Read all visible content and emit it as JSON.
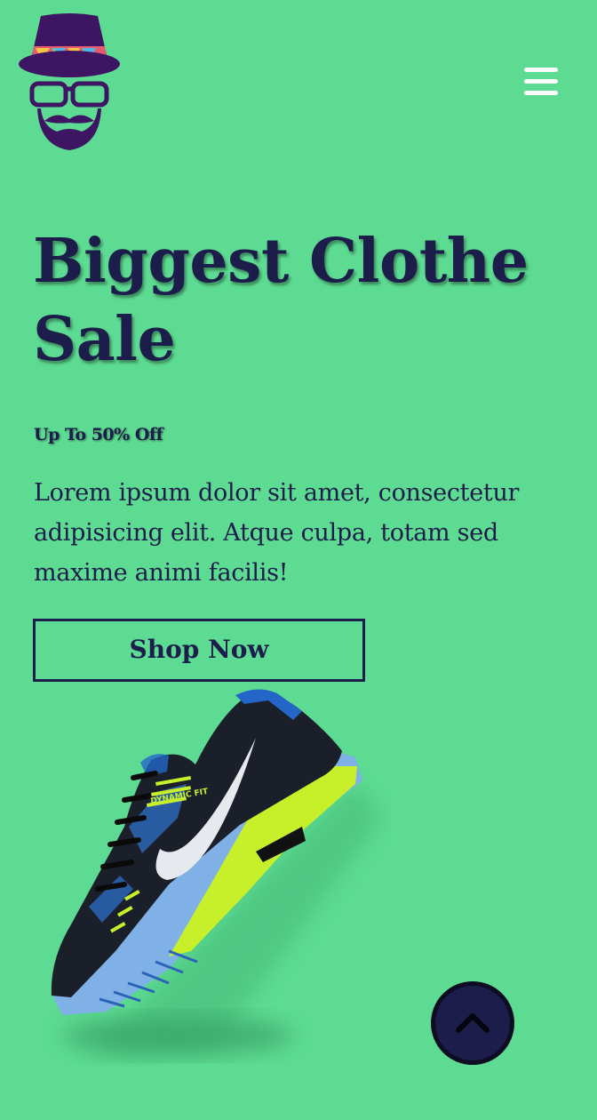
{
  "header": {
    "logo_icon": "hipster-man-hat-glasses-beard-icon",
    "menu_icon": "hamburger-menu-icon"
  },
  "hero": {
    "title": "Biggest Clothe Sale",
    "subtitle": "Up To 50% Off",
    "description": "Lorem ipsum dolor sit amet, consectetur adipisicing elit. Atque culpa, totam sed maxime animi facilis!",
    "cta_label": "Shop Now",
    "product_image": "running-sneaker-image",
    "shoe_print": "DYNAMIC FIT"
  },
  "scroll_top": {
    "icon": "chevron-up-icon"
  },
  "colors": {
    "background": "#5ddb92",
    "text": "#1c1d4a",
    "accent_purple": "#3d1563",
    "white": "#ffffff"
  }
}
